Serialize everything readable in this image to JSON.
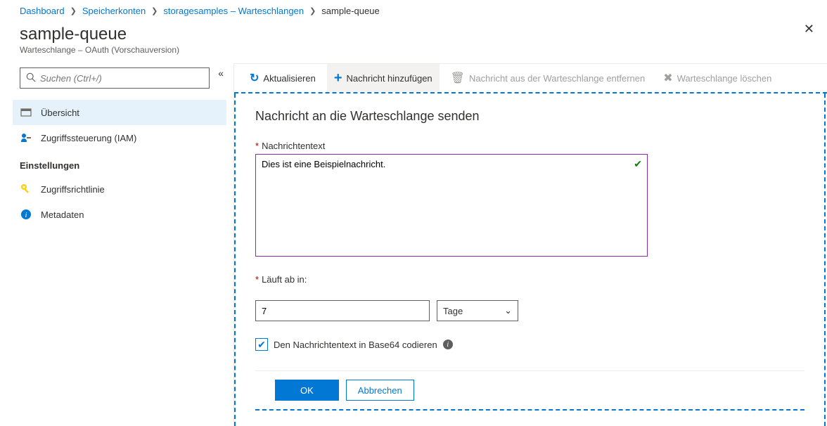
{
  "breadcrumb": {
    "items": [
      {
        "label": "Dashboard",
        "link": true
      },
      {
        "label": "Speicherkonten",
        "link": true
      },
      {
        "label": "storagesamples – Warteschlangen",
        "link": true
      },
      {
        "label": "sample-queue",
        "link": false
      }
    ]
  },
  "header": {
    "title": "sample-queue",
    "subtitle": "Warteschlange – OAuth (Vorschauversion)"
  },
  "sidebar": {
    "search_placeholder": "Suchen (Ctrl+/)",
    "items": [
      {
        "label": "Übersicht",
        "icon": "overview",
        "active": true
      },
      {
        "label": "Zugriffssteuerung (IAM)",
        "icon": "iam",
        "active": false
      }
    ],
    "group_label": "Einstellungen",
    "group_items": [
      {
        "label": "Zugriffsrichtlinie",
        "icon": "key"
      },
      {
        "label": "Metadaten",
        "icon": "info"
      }
    ]
  },
  "toolbar": {
    "refresh": "Aktualisieren",
    "add": "Nachricht hinzufügen",
    "remove": "Nachricht aus der Warteschlange entfernen",
    "delete": "Warteschlange löschen"
  },
  "form": {
    "title": "Nachricht an die Warteschlange senden",
    "msg_label": "Nachrichtentext",
    "msg_value": "Dies ist eine Beispielnachricht.",
    "expire_label": "Läuft ab in:",
    "expire_value": "7",
    "expire_unit": "Tage",
    "base64_label": "Den Nachrichtentext in Base64 codieren",
    "base64_checked": true
  },
  "footer": {
    "ok": "OK",
    "cancel": "Abbrechen"
  }
}
